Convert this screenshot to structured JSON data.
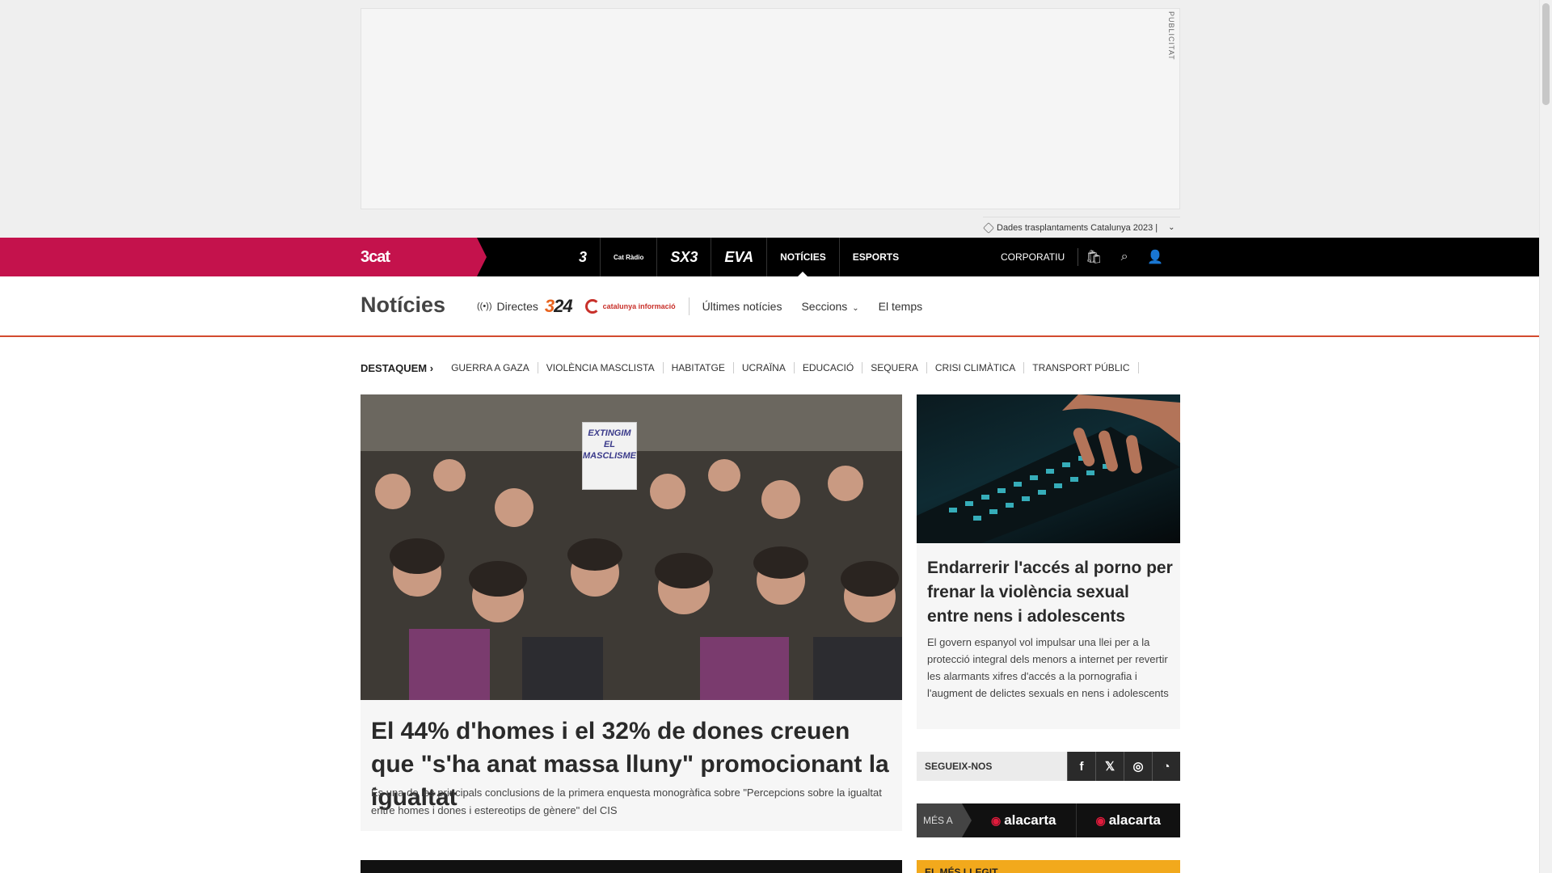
{
  "ad": {
    "label": "PUBLICITAT"
  },
  "promo": {
    "text": "Dades trasplantaments Catalunya 2023 |"
  },
  "topnav": {
    "brand": "3cat",
    "channels": [
      "3",
      "Cat Ràdio",
      "SX3",
      "EVA"
    ],
    "links": [
      "NOTÍCIES",
      "ESPORTS"
    ],
    "corporate": "CORPORATIU"
  },
  "section": {
    "title": "Notícies",
    "live": "Directes",
    "logo324": "324",
    "logo_cat_info": "catalunya informació",
    "menu": [
      "Últimes notícies",
      "Seccions",
      "El temps"
    ]
  },
  "highlights": {
    "label": "DESTAQUEM",
    "items": [
      "GUERRA A GAZA",
      "VIOLÈNCIA MASCLISTA",
      "HABITATGE",
      "UCRAÏNA",
      "EDUCACIÓ",
      "SEQUERA",
      "CRISI CLIMÀTICA",
      "TRANSPORT PÚBLIC"
    ]
  },
  "main_story": {
    "placard": "EXTINGIM EL MASCLISME",
    "headline": "El 44% d'homes i el 32% de dones creuen que \"s'ha anat massa lluny\" promocionant la igualtat",
    "summary": "És una de les principals conclusions de la primera enquesta monogràfica sobre \"Percepcions sobre la igualtat entre homes i dones i estereotips de gènere\" del CIS"
  },
  "side_story": {
    "headline": "Endarrerir l'accés al porno per frenar la violència sexual entre nens i adolescents",
    "summary": "El govern espanyol vol impulsar una llei per a la protecció integral dels menors a internet per revertir les alarmants xifres d'accés a la pornografia i l'augment de delictes sexuals en nens i adolescents"
  },
  "follow": {
    "label": "SEGUEIX-NOS",
    "networks": [
      "facebook",
      "x",
      "instagram",
      "rss"
    ]
  },
  "mesa": {
    "label": "MÉS A",
    "items": [
      "alacarta",
      "alacarta"
    ]
  },
  "bottom": {
    "right_title": "EL MÉS LLEGIT"
  },
  "colors": {
    "brand": "#c4124c",
    "accent": "#d34b2f",
    "bar": "#000000"
  }
}
